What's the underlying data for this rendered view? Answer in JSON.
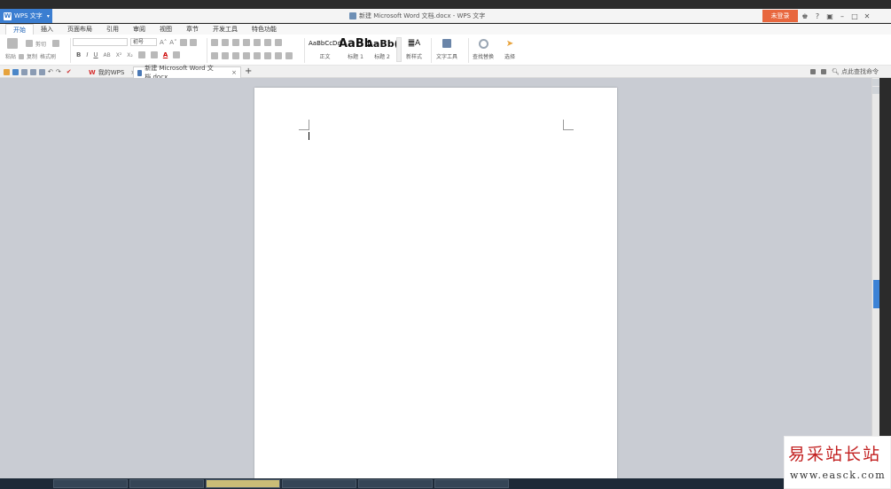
{
  "titlebar": {
    "app_name": "WPS 文字",
    "app_logo": "W",
    "document_title": "新建 Microsoft Word 文档.docx - WPS 文字",
    "login_label": "未登录",
    "help_label": "?",
    "window_controls": [
      "–",
      "□",
      "✕"
    ]
  },
  "menu": {
    "items": [
      "开始",
      "插入",
      "页面布局",
      "引用",
      "审阅",
      "视图",
      "章节",
      "开发工具",
      "特色功能"
    ],
    "active": "开始"
  },
  "ribbon": {
    "paste_label": "粘贴",
    "cut_label": "剪切",
    "copy_label": "复制",
    "format_painter_label": "格式刷",
    "font_name": "",
    "font_size": "初号",
    "styles": [
      {
        "sample": "AaBbCcDd",
        "name": "正文"
      },
      {
        "sample": "AaBb",
        "name": "标题 1"
      },
      {
        "sample": "AaBb(",
        "name": "标题 2"
      }
    ],
    "new_style_label": "新样式",
    "text_tools_label": "文字工具",
    "find_replace_label": "查找替换",
    "select_label": "选择"
  },
  "tabs": {
    "home_tab_label": "我的WPS",
    "doc_tab_label": "新建 Microsoft Word 文档.docx",
    "add_tab": "+",
    "search_command": "点此查找命令"
  },
  "watermark": {
    "text": "易采站长站",
    "url": "www.easck.com"
  },
  "colors": {
    "accent": "#3b7ed1",
    "login": "#e8673e",
    "workspace": "#c9ccd3",
    "watermark_red": "#c21f1f"
  }
}
